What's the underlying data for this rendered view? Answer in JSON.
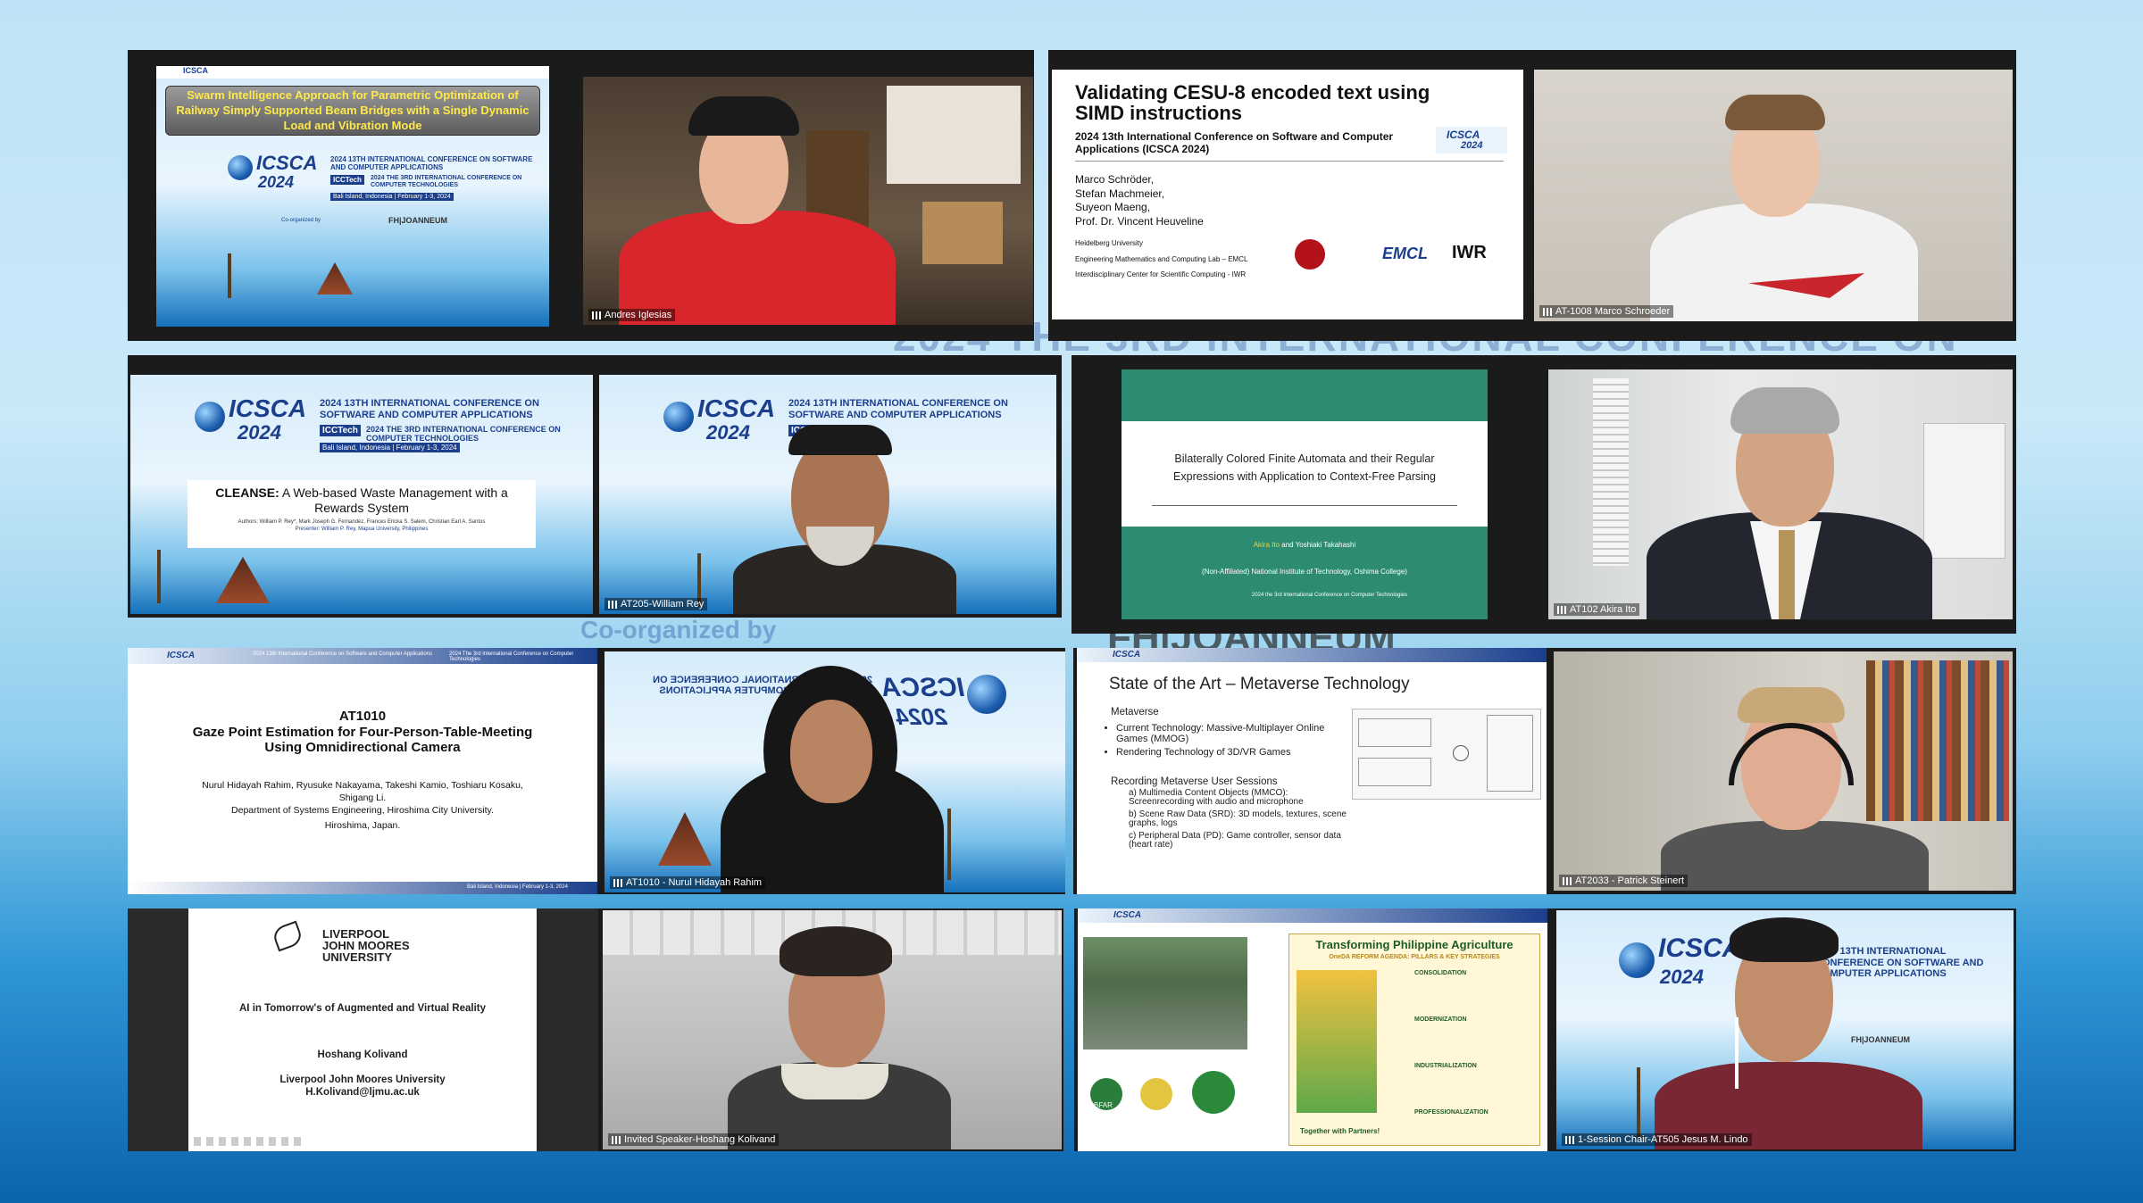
{
  "background": {
    "line1": "2024 THE 3RD INTERNATIONAL CONFERENCE ON",
    "coorg": "Co-organized by",
    "joanneum": "FH|JOANNEUM"
  },
  "conf": {
    "logo": "ICSCA",
    "year": "2024",
    "head1": "2024 13TH INTERNATIONAL CONFERENCE ON SOFTWARE AND COMPUTER APPLICATIONS",
    "icctech": "ICCTech",
    "head2": "2024 THE 3RD INTERNATIONAL CONFERENCE ON COMPUTER TECHNOLOGIES",
    "location": "Bali Island, Indonesia | February 1-3, 2024",
    "coorganized": "Co-organized by",
    "banner": "2024 13th International Conference on Software and Computer Applications",
    "banner2": "2024 The 3rd International Conference on Computer Technologies"
  },
  "tiles": {
    "t1": {
      "title": "Swarm Intelligence Approach for Parametric Optimization of Railway Simply Supported Beam Bridges with a Single Dynamic Load and Vibration Mode",
      "joanneum": "FH|JOANNEUM"
    },
    "t2": {
      "label": "Andres Iglesias"
    },
    "t3": {
      "title": "Validating CESU-8 encoded text using SIMD instructions",
      "conf": "2024 13th International Conference on Software and Computer Applications (ICSCA 2024)",
      "authors": [
        "Marco Schröder,",
        "Stefan Machmeier,",
        "Suyeon Maeng,",
        "Prof. Dr. Vincent Heuveline"
      ],
      "affil": [
        "Heidelberg University",
        "Engineering Mathematics and Computing Lab – EMCL",
        "Interdisciplinary Center for Scientific Computing - IWR"
      ],
      "emcl": "EMCL",
      "iwr": "IWR"
    },
    "t4": {
      "label": "AT-1008 Marco Schroeder"
    },
    "t5": {
      "title_bold": "CLEANSE:",
      "title_rest": " A Web-based Waste Management with a Rewards System",
      "authors": "Authors: William P. Rey*, Mark Joseph G. Fernandez, Frances Ericka S. Salem, Christian Earl A. Santos",
      "presenter": "Presenter: William P. Rey, Mapua University, Philippines"
    },
    "t6": {
      "label": "AT205-William Rey"
    },
    "t7": {
      "title": "Bilaterally Colored Finite Automata and their Regular Expressions with Application to Context-Free Parsing",
      "authors_a": "Akira Ito",
      "authors_b": " and Yoshiaki Takahashi",
      "affil": "(Non-Affiliated)  National Institute of Technology, Oshima College)",
      "conf": "2024 the 3rd International Conference on Computer Technologies"
    },
    "t8": {
      "label": "AT102 Akira Ito"
    },
    "t9": {
      "code": "AT1010",
      "title": "Gaze Point Estimation for Four-Person-Table-Meeting Using Omnidirectional Camera",
      "authors": "Nurul Hidayah Rahim, Ryusuke Nakayama, Takeshi Kamio, Toshiaru Kosaku, Shigang Li.",
      "dept": "Department of Systems Engineering, Hiroshima City University.",
      "city": "Hiroshima, Japan.",
      "footer": "Bali Island, Indonesia | February 1-3, 2024"
    },
    "t10": {
      "label": "AT1010 - Nurul Hidayah Rahim"
    },
    "t11": {
      "title": "State of the Art – Metaverse Technology",
      "section": "Metaverse",
      "bullets": [
        "Current Technology: Massive-Multiplayer Online Games (MMOG)",
        "Rendering Technology of 3D/VR Games"
      ],
      "section2": "Recording Metaverse User Sessions",
      "items": [
        "a)   Multimedia Content Objects (MMCO): Screenrecording with audio and microphone",
        "b)   Scene Raw Data (SRD): 3D models, textures, scene graphs, logs",
        "c)   Peripheral Data (PD): Game controller, sensor data (heart rate)"
      ]
    },
    "t12": {
      "label": "AT2033 - Patrick Steinert"
    },
    "t13": {
      "uni1": "LIVERPOOL",
      "uni2": "JOHN MOORES",
      "uni3": "UNIVERSITY",
      "title": "AI in Tomorrow's of Augmented and Virtual Reality",
      "name": "Hoshang Kolivand",
      "org": "Liverpool John Moores University",
      "email": "H.Kolivand@ljmu.ac.uk"
    },
    "t14": {
      "label": "Invited Speaker-Hoshang Kolivand"
    },
    "t15": {
      "title": "Transforming Philippine Agriculture",
      "subtitle": "OneDA REFORM AGENDA: PILLARS & KEY STRATEGIES",
      "pillars": [
        "CONSOLIDATION",
        "MODERNIZATION",
        "INDUSTRIALIZATION",
        "PROFESSIONALIZATION"
      ],
      "tagline": "Together with Partners!",
      "bfar": "BFAR"
    },
    "t16": {
      "label": "1-Session Chair-AT505 Jesus M. Lindo"
    }
  },
  "colors": {
    "slide_blue": "#1b3f8c",
    "green_slide": "#2c8b70",
    "shirt_red": "#d8262c"
  }
}
